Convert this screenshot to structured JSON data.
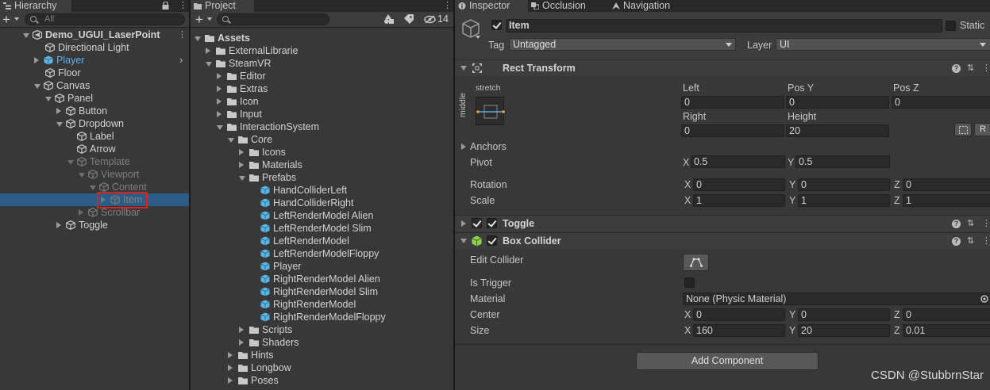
{
  "hierarchy": {
    "tab_label": "Hierarchy",
    "search_placeholder": "All",
    "items": [
      {
        "label": "Demo_UGUI_LaserPoint",
        "icon": "unity-scene-icon"
      },
      {
        "label": "Directional Light",
        "icon": "gameobject-icon"
      },
      {
        "label": "Player",
        "icon": "prefab-icon"
      },
      {
        "label": "Floor",
        "icon": "gameobject-icon"
      },
      {
        "label": "Canvas",
        "icon": "gameobject-icon"
      },
      {
        "label": "Panel",
        "icon": "gameobject-icon"
      },
      {
        "label": "Button",
        "icon": "gameobject-icon"
      },
      {
        "label": "Dropdown",
        "icon": "gameobject-icon"
      },
      {
        "label": "Label",
        "icon": "gameobject-icon"
      },
      {
        "label": "Arrow",
        "icon": "gameobject-icon"
      },
      {
        "label": "Template",
        "icon": "gameobject-icon"
      },
      {
        "label": "Viewport",
        "icon": "gameobject-icon"
      },
      {
        "label": "Content",
        "icon": "gameobject-icon"
      },
      {
        "label": "Item",
        "icon": "gameobject-icon"
      },
      {
        "label": "Scrollbar",
        "icon": "gameobject-icon"
      },
      {
        "label": "Toggle",
        "icon": "gameobject-icon"
      }
    ]
  },
  "project": {
    "tab_label": "Project",
    "hidden_count": "14",
    "items": [
      {
        "label": "Assets",
        "icon": "folder-icon"
      },
      {
        "label": "ExternalLibrarie",
        "icon": "folder-icon"
      },
      {
        "label": "SteamVR",
        "icon": "folder-icon"
      },
      {
        "label": "Editor",
        "icon": "folder-icon"
      },
      {
        "label": "Extras",
        "icon": "folder-icon"
      },
      {
        "label": "Icon",
        "icon": "folder-icon"
      },
      {
        "label": "Input",
        "icon": "folder-icon"
      },
      {
        "label": "InteractionSystem",
        "icon": "folder-icon"
      },
      {
        "label": "Core",
        "icon": "folder-icon"
      },
      {
        "label": "Icons",
        "icon": "folder-icon"
      },
      {
        "label": "Materials",
        "icon": "folder-icon"
      },
      {
        "label": "Prefabs",
        "icon": "folder-icon"
      },
      {
        "label": "HandColliderLeft",
        "icon": "prefab-icon"
      },
      {
        "label": "HandColliderRight",
        "icon": "prefab-icon"
      },
      {
        "label": "LeftRenderModel Alien",
        "icon": "prefab-icon"
      },
      {
        "label": "LeftRenderModel Slim",
        "icon": "prefab-icon"
      },
      {
        "label": "LeftRenderModel",
        "icon": "prefab-icon"
      },
      {
        "label": "LeftRenderModelFloppy",
        "icon": "prefab-icon"
      },
      {
        "label": "Player",
        "icon": "prefab-icon"
      },
      {
        "label": "RightRenderModel Alien",
        "icon": "prefab-icon"
      },
      {
        "label": "RightRenderModel Slim",
        "icon": "prefab-icon"
      },
      {
        "label": "RightRenderModel",
        "icon": "prefab-icon"
      },
      {
        "label": "RightRenderModelFloppy",
        "icon": "prefab-icon"
      },
      {
        "label": "Scripts",
        "icon": "folder-icon"
      },
      {
        "label": "Shaders",
        "icon": "folder-icon"
      },
      {
        "label": "Hints",
        "icon": "folder-icon"
      },
      {
        "label": "Longbow",
        "icon": "folder-icon"
      },
      {
        "label": "Poses",
        "icon": "folder-icon"
      }
    ]
  },
  "inspector": {
    "tabs": [
      "Inspector",
      "Occlusion",
      "Navigation"
    ],
    "object_name": "Item",
    "static_label": "Static",
    "tag_label": "Tag",
    "tag_value": "Untagged",
    "layer_label": "Layer",
    "layer_value": "UI",
    "rect_transform": {
      "title": "Rect Transform",
      "anchor_h": "stretch",
      "anchor_v": "middle",
      "left_label": "Left",
      "left": "0",
      "posy_label": "Pos Y",
      "posy": "0",
      "posz_label": "Pos Z",
      "posz": "0",
      "right_label": "Right",
      "right": "0",
      "height_label": "Height",
      "height": "20",
      "r_button": "R",
      "anchors_label": "Anchors",
      "pivot_label": "Pivot",
      "pivot_x": "0.5",
      "pivot_y": "0.5",
      "rotation_label": "Rotation",
      "rot_x": "0",
      "rot_y": "0",
      "rot_z": "0",
      "scale_label": "Scale",
      "scale_x": "1",
      "scale_y": "1",
      "scale_z": "1"
    },
    "toggle": {
      "title": "Toggle"
    },
    "box_collider": {
      "title": "Box Collider",
      "edit_collider_label": "Edit Collider",
      "is_trigger_label": "Is Trigger",
      "material_label": "Material",
      "material_value": "None (Physic Material)",
      "center_label": "Center",
      "center_x": "0",
      "center_y": "0",
      "center_z": "0",
      "size_label": "Size",
      "size_x": "160",
      "size_y": "20",
      "size_z": "0.01"
    },
    "add_component": "Add Component",
    "axis_x": "X",
    "axis_y": "Y",
    "axis_z": "Z"
  },
  "watermark": "CSDN @StubbrnStar",
  "colors": {
    "selection": "#2c5d87",
    "highlight_border": "#e0201c",
    "prefab": "#5bb6e8"
  }
}
